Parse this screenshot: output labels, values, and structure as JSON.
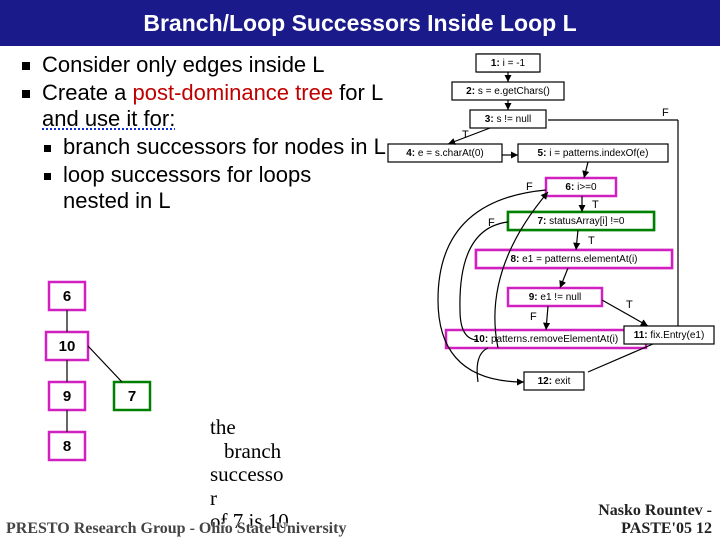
{
  "title": "Branch/Loop Successors Inside Loop L",
  "bullets": {
    "b1": "Consider only edges inside L",
    "b2_pre": "Create a ",
    "b2_red": "post-dominance tree",
    "b2_post": " for L",
    "b2_dotted": " and use it for:",
    "b2a": "branch successors for nodes in L",
    "b2b": "loop successors for loops nested in L"
  },
  "branch_note": {
    "l1": "the",
    "l2": "branch",
    "l3": "successo",
    "l4": "r",
    "l5": "of 7 is 10"
  },
  "tree": {
    "n": [
      "6",
      "10",
      "9",
      "8",
      "7"
    ]
  },
  "flow": {
    "n1": "1: i = -1",
    "n2": "2: s = e.getChars()",
    "n3": "3: s != null",
    "n4": "4: e = s.charAt(0)",
    "n5": "5: i = patterns.indexOf(e)",
    "n6": "6: i>=0",
    "n7": "7: statusArray[i] !=0",
    "n8": "8: e1 = patterns.elementAt(i)",
    "n9": "9: e1 != null",
    "n10": "10: patterns.removeElementAt(i)",
    "n11": "11: fix.Entry(e1)",
    "n12": "12: exit",
    "T": "T",
    "F": "F"
  },
  "footer": {
    "left": "PRESTO Research Group - Ohio State University",
    "right_a": "Nasko Rountev -",
    "right_b": "PASTE'05  12"
  }
}
